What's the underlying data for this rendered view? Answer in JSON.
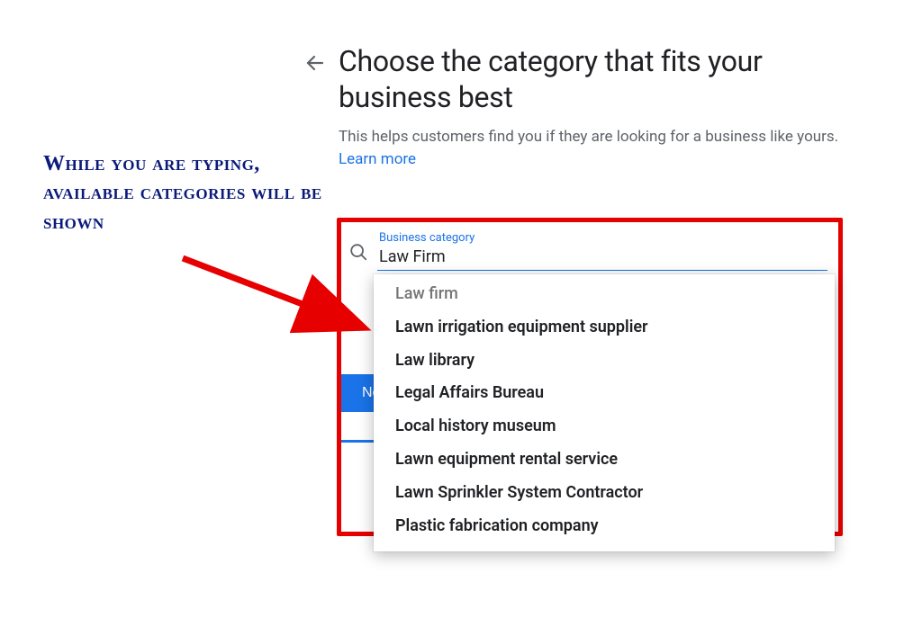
{
  "annotation": {
    "text": "While you are typing, available categories will be shown"
  },
  "header": {
    "title": "Choose the category that fits your business best",
    "subtext_prefix": "This helps customers find you if they are looking for a business like yours. ",
    "learn_more": "Learn more"
  },
  "form": {
    "field_label": "Business category",
    "input_value": "Law Firm",
    "next_label": "Next"
  },
  "suggestions": [
    "Law firm",
    "Lawn irrigation equipment supplier",
    "Law library",
    "Legal Affairs Bureau",
    "Local history museum",
    "Lawn equipment rental service",
    "Lawn Sprinkler System Contractor",
    "Plastic fabrication company"
  ],
  "colors": {
    "annotation": "#0a1a7a",
    "highlight": "#e60000",
    "primary": "#1a73e8"
  }
}
